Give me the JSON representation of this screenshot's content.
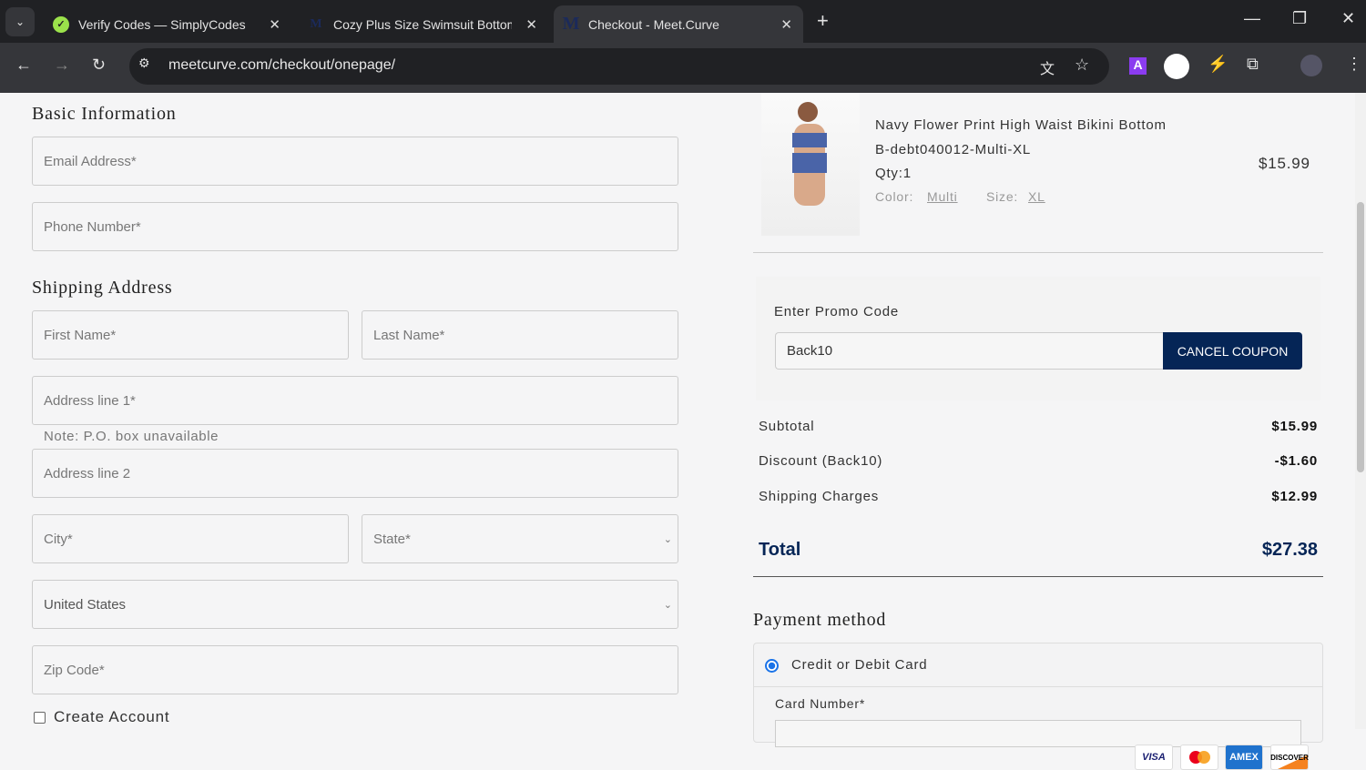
{
  "browser": {
    "tabs": [
      {
        "title": "Verify Codes — SimplyCodes"
      },
      {
        "title": "Cozy Plus Size Swimsuit Bottom"
      },
      {
        "title": "Checkout - Meet.Curve"
      }
    ],
    "url": "meetcurve.com/checkout/onepage/"
  },
  "form": {
    "basic_title": "Basic Information",
    "email": "Email Address*",
    "phone": "Phone Number*",
    "shipping_title": "Shipping Address",
    "first": "First Name*",
    "last": "Last Name*",
    "addr1": "Address line 1*",
    "po_note": "Note: P.O. box unavailable",
    "addr2": "Address line 2",
    "city": "City*",
    "state": "State*",
    "country": "United States",
    "zip": "Zip Code*",
    "create_account": "Create Account"
  },
  "cart": {
    "item": {
      "name": "Navy Flower Print High Waist Bikini Bottom",
      "sku": "B-debt040012-Multi-XL",
      "qty": "Qty:1",
      "color_label": "Color:",
      "color": "Multi",
      "size_label": "Size:",
      "size": "XL",
      "price": "$15.99"
    },
    "promo": {
      "label": "Enter Promo Code",
      "value": "Back10",
      "button": "CANCEL COUPON"
    },
    "summary": [
      {
        "label": "Subtotal",
        "value": "$15.99"
      },
      {
        "label": "Discount (Back10)",
        "value": "-$1.60"
      },
      {
        "label": "Shipping Charges",
        "value": "$12.99"
      }
    ],
    "total": {
      "label": "Total",
      "value": "$27.38"
    }
  },
  "payment": {
    "title": "Payment method",
    "option": "Credit or Debit Card",
    "cards": [
      "VISA",
      "",
      "AMEX",
      "DISCOVER"
    ],
    "card_number": "Card Number*"
  },
  "colors": {
    "navy": "#052556"
  }
}
